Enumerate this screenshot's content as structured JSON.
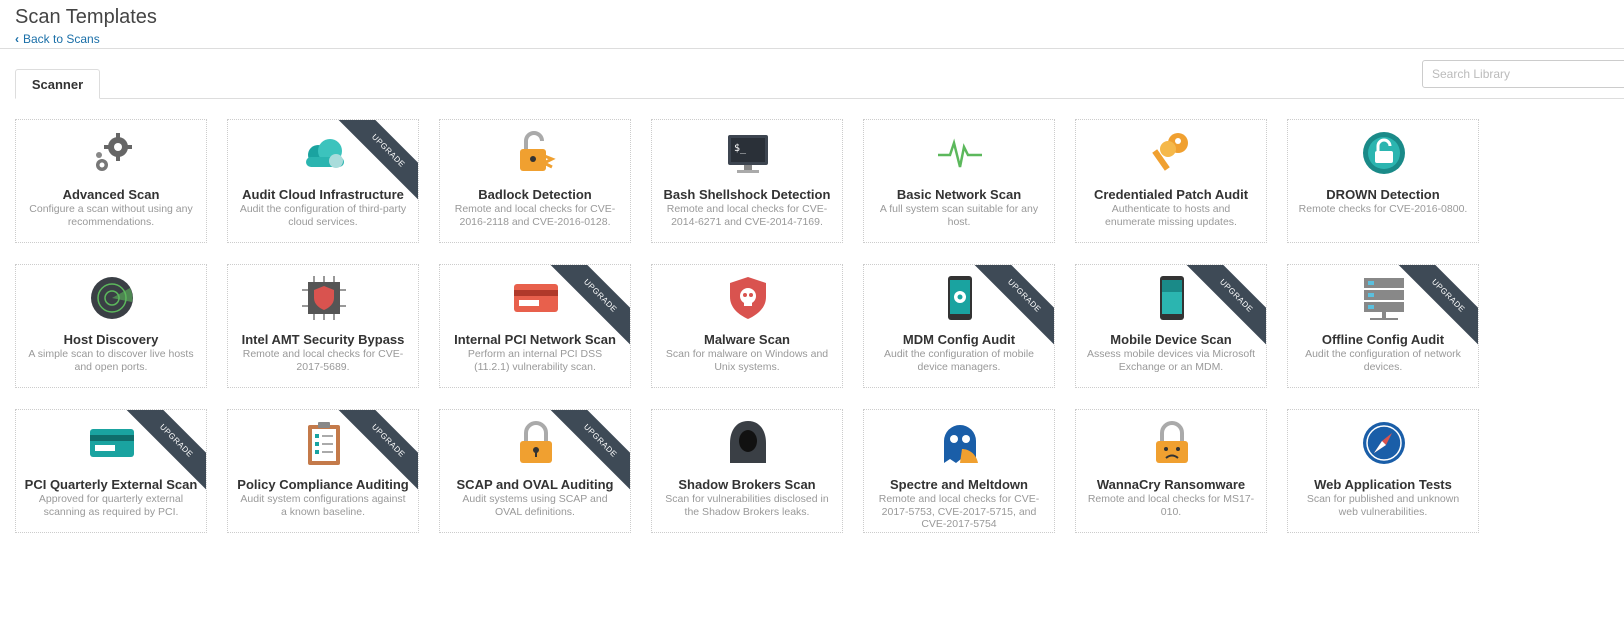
{
  "header": {
    "title": "Scan Templates",
    "back_label": "Back to Scans"
  },
  "tabs": [
    {
      "label": "Scanner"
    }
  ],
  "search": {
    "placeholder": "Search Library"
  },
  "colors": {
    "link": "#1a6fa8",
    "ribbon": "#3e4a56",
    "teal": "#1aa3a0",
    "orange": "#f0a030"
  },
  "ribbon_label": "UPGRADE",
  "templates": [
    {
      "title": "Advanced Scan",
      "desc": "Configure a scan without using any recommendations.",
      "icon": "gears-icon",
      "upgrade": false
    },
    {
      "title": "Audit Cloud Infrastructure",
      "desc": "Audit the configuration of third-party cloud services.",
      "icon": "cloud-icon",
      "upgrade": true
    },
    {
      "title": "Badlock Detection",
      "desc": "Remote and local checks for CVE-2016-2118 and CVE-2016-0128.",
      "icon": "broken-lock-icon",
      "upgrade": false
    },
    {
      "title": "Bash Shellshock Detection",
      "desc": "Remote and local checks for CVE-2014-6271 and CVE-2014-7169.",
      "icon": "terminal-icon",
      "upgrade": false
    },
    {
      "title": "Basic Network Scan",
      "desc": "A full system scan suitable for any host.",
      "icon": "pulse-icon",
      "upgrade": false
    },
    {
      "title": "Credentialed Patch Audit",
      "desc": "Authenticate to hosts and enumerate missing updates.",
      "icon": "keys-icon",
      "upgrade": false
    },
    {
      "title": "DROWN Detection",
      "desc": "Remote checks for CVE-2016-0800.",
      "icon": "drown-lock-icon",
      "upgrade": false
    },
    {
      "title": "Host Discovery",
      "desc": "A simple scan to discover live hosts and open ports.",
      "icon": "radar-icon",
      "upgrade": false
    },
    {
      "title": "Intel AMT Security Bypass",
      "desc": "Remote and local checks for CVE-2017-5689.",
      "icon": "chip-shield-icon",
      "upgrade": false
    },
    {
      "title": "Internal PCI Network Scan",
      "desc": "Perform an internal PCI DSS (11.2.1) vulnerability scan.",
      "icon": "red-card-icon",
      "upgrade": true
    },
    {
      "title": "Malware Scan",
      "desc": "Scan for malware on Windows and Unix systems.",
      "icon": "skull-shield-icon",
      "upgrade": false
    },
    {
      "title": "MDM Config Audit",
      "desc": "Audit the configuration of mobile device managers.",
      "icon": "phone-gear-icon",
      "upgrade": true
    },
    {
      "title": "Mobile Device Scan",
      "desc": "Assess mobile devices via Microsoft Exchange or an MDM.",
      "icon": "phone-icon",
      "upgrade": true
    },
    {
      "title": "Offline Config Audit",
      "desc": "Audit the configuration of network devices.",
      "icon": "server-icon",
      "upgrade": true
    },
    {
      "title": "PCI Quarterly External Scan",
      "desc": "Approved for quarterly external scanning as required by PCI.",
      "icon": "teal-card-icon",
      "upgrade": true
    },
    {
      "title": "Policy Compliance Auditing",
      "desc": "Audit system configurations against a known baseline.",
      "icon": "clipboard-icon",
      "upgrade": true
    },
    {
      "title": "SCAP and OVAL Auditing",
      "desc": "Audit systems using SCAP and OVAL definitions.",
      "icon": "lock-icon",
      "upgrade": true
    },
    {
      "title": "Shadow Brokers Scan",
      "desc": "Scan for vulnerabilities disclosed in the Shadow Brokers leaks.",
      "icon": "hooded-figure-icon",
      "upgrade": false
    },
    {
      "title": "Spectre and Meltdown",
      "desc": "Remote and local checks for CVE-2017-5753, CVE-2017-5715, and CVE-2017-5754",
      "icon": "ghost-icon",
      "upgrade": false
    },
    {
      "title": "WannaCry Ransomware",
      "desc": "Remote and local checks for MS17-010.",
      "icon": "sad-lock-icon",
      "upgrade": false
    },
    {
      "title": "Web Application Tests",
      "desc": "Scan for published and unknown web vulnerabilities.",
      "icon": "compass-icon",
      "upgrade": false
    }
  ]
}
